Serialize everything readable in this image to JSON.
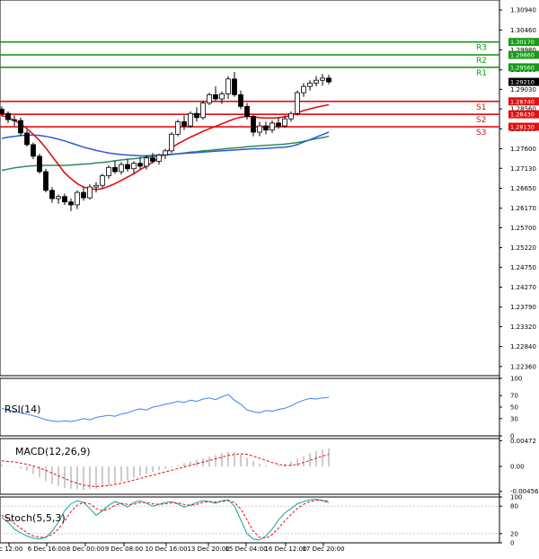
{
  "chart_data": {
    "type": "candlestick",
    "price_axis": {
      "ylim": [
        1.2214,
        1.3118
      ],
      "ticks": [
        "1.30940",
        "1.30460",
        "1.29980",
        "1.29500",
        "1.29030",
        "1.28560",
        "1.28080",
        "1.27600",
        "1.27130",
        "1.26650",
        "1.26170",
        "1.25700",
        "1.25220",
        "1.24750",
        "1.24270",
        "1.23790",
        "1.23320",
        "1.22840",
        "1.22360"
      ]
    },
    "levels": [
      {
        "name": "R3",
        "value": 1.3017,
        "tag": "1.30170",
        "color": "#1a9a1a"
      },
      {
        "name": "R2",
        "value": 1.2986,
        "tag": "1.29860",
        "color": "#1a9a1a"
      },
      {
        "name": "R1",
        "value": 1.2956,
        "tag": "1.29560",
        "color": "#1a9a1a"
      },
      {
        "name": "S1",
        "value": 1.2874,
        "tag": "1.28740",
        "color": "#e01010"
      },
      {
        "name": "S2",
        "value": 1.2843,
        "tag": "1.28430",
        "color": "#e01010"
      },
      {
        "name": "S3",
        "value": 1.2813,
        "tag": "1.28130",
        "color": "#e01010"
      }
    ],
    "current_price": {
      "value": 1.2921,
      "tag": "1.29210"
    },
    "x_labels": [
      "ec 12:00",
      "6 Dec 16:00",
      "8 Dec 00:00",
      "9 Dec 08:00",
      "10 Dec 16:00",
      "13 Dec 20:00",
      "15 Dec 04:00",
      "16 Dec 12:00",
      "17 Dec 20:00"
    ],
    "candles": [
      [
        1.2855,
        1.2862,
        1.2838,
        1.2845
      ],
      [
        1.2845,
        1.285,
        1.2822,
        1.283
      ],
      [
        1.283,
        1.284,
        1.2815,
        1.2828
      ],
      [
        1.2828,
        1.2835,
        1.279,
        1.2798
      ],
      [
        1.2798,
        1.2805,
        1.2765,
        1.277
      ],
      [
        1.277,
        1.2775,
        1.2735,
        1.2742
      ],
      [
        1.2742,
        1.2748,
        1.27,
        1.2705
      ],
      [
        1.2705,
        1.2712,
        1.2655,
        1.266
      ],
      [
        1.266,
        1.2668,
        1.263,
        1.264
      ],
      [
        1.264,
        1.265,
        1.2628,
        1.2645
      ],
      [
        1.2645,
        1.2652,
        1.2625,
        1.2632
      ],
      [
        1.2632,
        1.264,
        1.261,
        1.2625
      ],
      [
        1.2625,
        1.266,
        1.2615,
        1.2655
      ],
      [
        1.2655,
        1.2668,
        1.2635,
        1.2642
      ],
      [
        1.2642,
        1.2675,
        1.2638,
        1.2668
      ],
      [
        1.2668,
        1.268,
        1.2655,
        1.2672
      ],
      [
        1.2672,
        1.27,
        1.2665,
        1.2695
      ],
      [
        1.2695,
        1.272,
        1.2688,
        1.2715
      ],
      [
        1.2715,
        1.273,
        1.27,
        1.2705
      ],
      [
        1.2705,
        1.2728,
        1.2698,
        1.2722
      ],
      [
        1.2722,
        1.2735,
        1.2705,
        1.2712
      ],
      [
        1.2712,
        1.273,
        1.27,
        1.2725
      ],
      [
        1.2725,
        1.274,
        1.271,
        1.2718
      ],
      [
        1.2718,
        1.2745,
        1.271,
        1.2738
      ],
      [
        1.2738,
        1.275,
        1.2725,
        1.273
      ],
      [
        1.273,
        1.2748,
        1.2722,
        1.2745
      ],
      [
        1.2745,
        1.276,
        1.2735,
        1.2755
      ],
      [
        1.2755,
        1.28,
        1.275,
        1.2795
      ],
      [
        1.2795,
        1.283,
        1.279,
        1.2825
      ],
      [
        1.2825,
        1.284,
        1.2805,
        1.2815
      ],
      [
        1.2815,
        1.285,
        1.281,
        1.2845
      ],
      [
        1.2845,
        1.286,
        1.2825,
        1.2835
      ],
      [
        1.2835,
        1.2875,
        1.283,
        1.287
      ],
      [
        1.287,
        1.2895,
        1.2865,
        1.289
      ],
      [
        1.289,
        1.291,
        1.2875,
        1.288
      ],
      [
        1.288,
        1.2898,
        1.2868,
        1.2892
      ],
      [
        1.2892,
        1.2935,
        1.288,
        1.2928
      ],
      [
        1.2928,
        1.2945,
        1.2885,
        1.289
      ],
      [
        1.289,
        1.29,
        1.2855,
        1.2862
      ],
      [
        1.2862,
        1.287,
        1.283,
        1.2838
      ],
      [
        1.2838,
        1.2842,
        1.279,
        1.28
      ],
      [
        1.28,
        1.2825,
        1.279,
        1.2815
      ],
      [
        1.2815,
        1.2825,
        1.2795,
        1.2805
      ],
      [
        1.2805,
        1.2828,
        1.2798,
        1.2822
      ],
      [
        1.2822,
        1.2835,
        1.2808,
        1.2815
      ],
      [
        1.2815,
        1.284,
        1.281,
        1.2832
      ],
      [
        1.2832,
        1.285,
        1.2825,
        1.2845
      ],
      [
        1.2845,
        1.29,
        1.284,
        1.2895
      ],
      [
        1.2895,
        1.2918,
        1.2885,
        1.291
      ],
      [
        1.291,
        1.2925,
        1.29,
        1.2918
      ],
      [
        1.2918,
        1.2935,
        1.291,
        1.2925
      ],
      [
        1.2925,
        1.294,
        1.2912,
        1.293
      ],
      [
        1.293,
        1.2938,
        1.2915,
        1.2921
      ]
    ],
    "ma_red": [
      1.284,
      1.2835,
      1.2828,
      1.282,
      1.2808,
      1.2795,
      1.278,
      1.2762,
      1.2742,
      1.2722,
      1.2702,
      1.2688,
      1.2676,
      1.2668,
      1.2664,
      1.2662,
      1.2664,
      1.267,
      1.2676,
      1.2684,
      1.2692,
      1.27,
      1.271,
      1.2718,
      1.2728,
      1.2738,
      1.275,
      1.2762,
      1.2772,
      1.278,
      1.2788,
      1.2795,
      1.2802,
      1.2808,
      1.2814,
      1.282,
      1.2826,
      1.2832,
      1.2836,
      1.2838,
      1.2837,
      1.2835,
      1.2834,
      1.2834,
      1.2835,
      1.2837,
      1.284,
      1.2846,
      1.2852,
      1.2856,
      1.286,
      1.2863,
      1.2866
    ],
    "ma_blue": [
      1.2785,
      1.2788,
      1.279,
      1.2792,
      1.2793,
      1.2793,
      1.2792,
      1.279,
      1.2787,
      1.2783,
      1.2779,
      1.2774,
      1.2769,
      1.2764,
      1.276,
      1.2756,
      1.2753,
      1.275,
      1.2748,
      1.2746,
      1.2745,
      1.2744,
      1.2743,
      1.2743,
      1.2744,
      1.2745,
      1.2746,
      1.2747,
      1.2748,
      1.2749,
      1.275,
      1.2751,
      1.2752,
      1.2753,
      1.2754,
      1.2755,
      1.2756,
      1.2757,
      1.2758,
      1.2759,
      1.276,
      1.276,
      1.2761,
      1.2762,
      1.2763,
      1.2764,
      1.2766,
      1.277,
      1.2776,
      1.2782,
      1.2788,
      1.2794,
      1.28
    ],
    "ma_green": [
      1.2708,
      1.2711,
      1.2714,
      1.2716,
      1.2718,
      1.2719,
      1.272,
      1.272,
      1.272,
      1.272,
      1.272,
      1.2721,
      1.2722,
      1.2723,
      1.2724,
      1.2726,
      1.2727,
      1.2729,
      1.2731,
      1.2733,
      1.2735,
      1.2736,
      1.2738,
      1.274,
      1.2741,
      1.2743,
      1.2745,
      1.2746,
      1.2748,
      1.275,
      1.2752,
      1.2753,
      1.2755,
      1.2756,
      1.2758,
      1.2759,
      1.2761,
      1.2762,
      1.2763,
      1.2765,
      1.2766,
      1.2767,
      1.2768,
      1.2769,
      1.277,
      1.2771,
      1.2773,
      1.2775,
      1.2778,
      1.2781,
      1.2784,
      1.2787,
      1.279
    ],
    "rsi": {
      "label": "RSI(14)",
      "ylim": [
        0,
        100
      ],
      "ticks": [
        "100",
        "70",
        "50",
        "30",
        "0"
      ],
      "values": [
        48,
        45,
        43,
        40,
        38,
        35,
        32,
        28,
        26,
        25,
        26,
        25,
        27,
        30,
        28,
        32,
        34,
        36,
        34,
        38,
        40,
        44,
        47,
        45,
        50,
        52,
        55,
        57,
        60,
        58,
        62,
        60,
        64,
        66,
        63,
        68,
        72,
        62,
        55,
        45,
        42,
        40,
        44,
        43,
        46,
        48,
        52,
        58,
        62,
        65,
        64,
        66,
        67
      ]
    },
    "macd": {
      "label": "MACD(12,26,9)",
      "ylim": [
        -0.0051,
        0.0051
      ],
      "ticks": [
        "0.00472",
        "0.00",
        "-0.00456"
      ],
      "hist": [
        0.0003,
        0.0001,
        -0.0001,
        -0.0004,
        -0.0008,
        -0.0014,
        -0.002,
        -0.0027,
        -0.0032,
        -0.0036,
        -0.0039,
        -0.0041,
        -0.0042,
        -0.0043,
        -0.0042,
        -0.0041,
        -0.0038,
        -0.0035,
        -0.0032,
        -0.0028,
        -0.0025,
        -0.0021,
        -0.0017,
        -0.0014,
        -0.001,
        -0.0007,
        -0.0004,
        -0.0001,
        0.0002,
        0.0006,
        0.0009,
        0.0012,
        0.0015,
        0.0018,
        0.0021,
        0.0024,
        0.0027,
        0.0026,
        0.0022,
        0.0016,
        0.001,
        0.0005,
        0.0002,
        0.0,
        0.0002,
        0.0005,
        0.0009,
        0.0014,
        0.0019,
        0.0024,
        0.0028,
        0.0031,
        0.0033
      ],
      "signal": [
        0.001,
        0.0009,
        0.0008,
        0.0006,
        0.0004,
        0.0001,
        -0.0003,
        -0.0007,
        -0.0012,
        -0.0017,
        -0.0022,
        -0.0027,
        -0.0031,
        -0.0034,
        -0.0036,
        -0.0037,
        -0.0036,
        -0.0035,
        -0.0033,
        -0.0031,
        -0.0028,
        -0.0025,
        -0.0022,
        -0.0019,
        -0.0016,
        -0.0013,
        -0.001,
        -0.0007,
        -0.0004,
        -0.0001,
        0.0002,
        0.0005,
        0.0008,
        0.0011,
        0.0014,
        0.0017,
        0.002,
        0.0022,
        0.0023,
        0.0022,
        0.0019,
        0.0015,
        0.0011,
        0.0007,
        0.0004,
        0.0002,
        0.0002,
        0.0004,
        0.0007,
        0.0011,
        0.0015,
        0.0019,
        0.0022
      ]
    },
    "stoch": {
      "label": "Stoch(5,5,3)",
      "ylim": [
        0,
        100
      ],
      "ticks": [
        "100",
        "80",
        "20",
        "0"
      ],
      "k": [
        55,
        45,
        30,
        22,
        15,
        10,
        8,
        12,
        25,
        45,
        70,
        85,
        92,
        88,
        75,
        60,
        70,
        82,
        90,
        85,
        78,
        88,
        92,
        86,
        80,
        84,
        88,
        90,
        85,
        78,
        82,
        88,
        92,
        90,
        86,
        92,
        94,
        80,
        50,
        20,
        8,
        6,
        15,
        30,
        50,
        65,
        75,
        85,
        90,
        94,
        95,
        92,
        88
      ],
      "d": [
        60,
        52,
        42,
        32,
        22,
        15,
        12,
        12,
        18,
        30,
        48,
        68,
        82,
        88,
        85,
        75,
        70,
        74,
        82,
        86,
        84,
        84,
        88,
        88,
        85,
        84,
        85,
        87,
        87,
        84,
        82,
        84,
        88,
        90,
        89,
        90,
        92,
        88,
        74,
        50,
        25,
        12,
        10,
        18,
        32,
        48,
        62,
        75,
        84,
        90,
        93,
        93,
        91
      ]
    }
  }
}
